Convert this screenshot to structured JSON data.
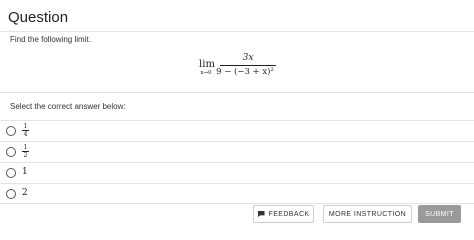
{
  "header": {
    "title": "Question"
  },
  "question": {
    "prompt": "Find the following limit.",
    "formula": {
      "lim_word": "lim",
      "lim_subscript": "x→0",
      "numerator": "3x",
      "denominator": "9 − (−3 + x)²"
    },
    "select_label": "Select the correct answer below:"
  },
  "options": [
    {
      "type": "fraction",
      "numerator": "1",
      "denominator": "4"
    },
    {
      "type": "fraction",
      "numerator": "1",
      "denominator": "2"
    },
    {
      "type": "text",
      "value": "1"
    },
    {
      "type": "text",
      "value": "2"
    }
  ],
  "buttons": {
    "feedback": "FEEDBACK",
    "more_instruction": "MORE INSTRUCTION",
    "submit": "SUBMIT"
  },
  "colors": {
    "submit_bg": "#9a9a9a",
    "divider": "#e3e3e3"
  }
}
